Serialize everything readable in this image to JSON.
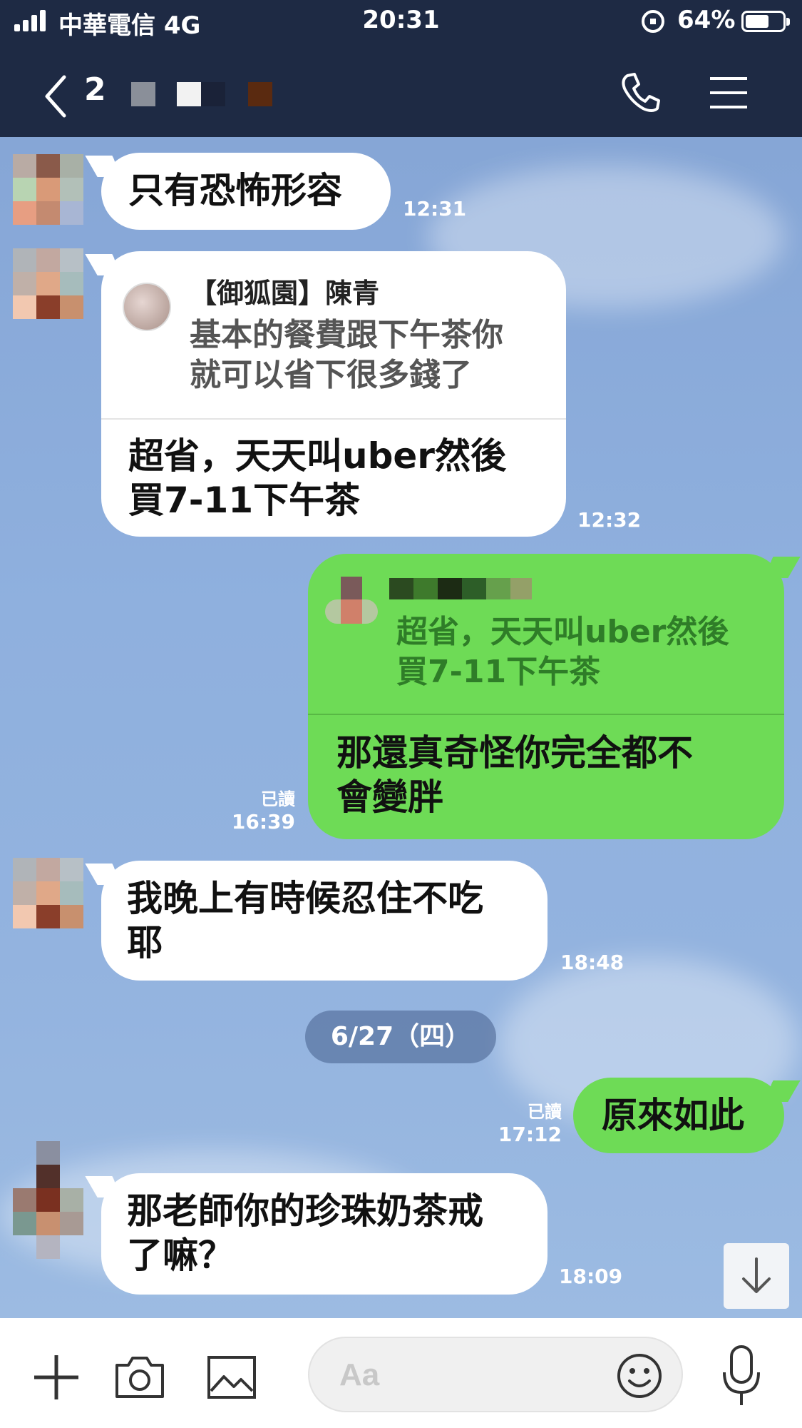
{
  "status_bar": {
    "carrier": "中華電信 4G",
    "time": "20:31",
    "battery_percent": "64%",
    "battery_level": 0.64
  },
  "header": {
    "member_count": "2",
    "icons": [
      "back-chevron-icon",
      "phone-icon",
      "menu-icon"
    ]
  },
  "messages": [
    {
      "text": "只有恐怖形容",
      "time": "12:31"
    },
    {
      "quote": {
        "name": "【御狐園】陳青",
        "text_lines": [
          "基本的餐費跟下午茶你",
          "就可以省下很多錢了"
        ]
      },
      "text_lines": [
        "超省，天天叫uber然後",
        "買7-11下午茶"
      ],
      "time": "12:32"
    },
    {
      "quote": {
        "text_lines": [
          "超省，天天叫uber然後",
          "買7-11下午茶"
        ]
      },
      "text_lines": [
        "那還真奇怪你完全都不",
        "會變胖"
      ],
      "read": "已讀",
      "time": "16:39"
    },
    {
      "text_lines": [
        "我晚上有時候忍住不吃",
        "耶"
      ],
      "time": "18:48"
    },
    {
      "text": "原來如此",
      "read": "已讀",
      "time": "17:12"
    },
    {
      "text_lines": [
        "那老師你的珍珠奶茶戒",
        "了嘛？"
      ],
      "time": "18:09"
    }
  ],
  "date_separator": "6/27（四）",
  "input_bar": {
    "placeholder": "Aa",
    "icons": [
      "plus-icon",
      "camera-icon",
      "image-icon",
      "emoji-icon",
      "microphone-icon"
    ]
  },
  "colors": {
    "header_bg": "#1e2a44",
    "outgoing_bubble": "#6edb56",
    "incoming_bubble": "#ffffff"
  }
}
